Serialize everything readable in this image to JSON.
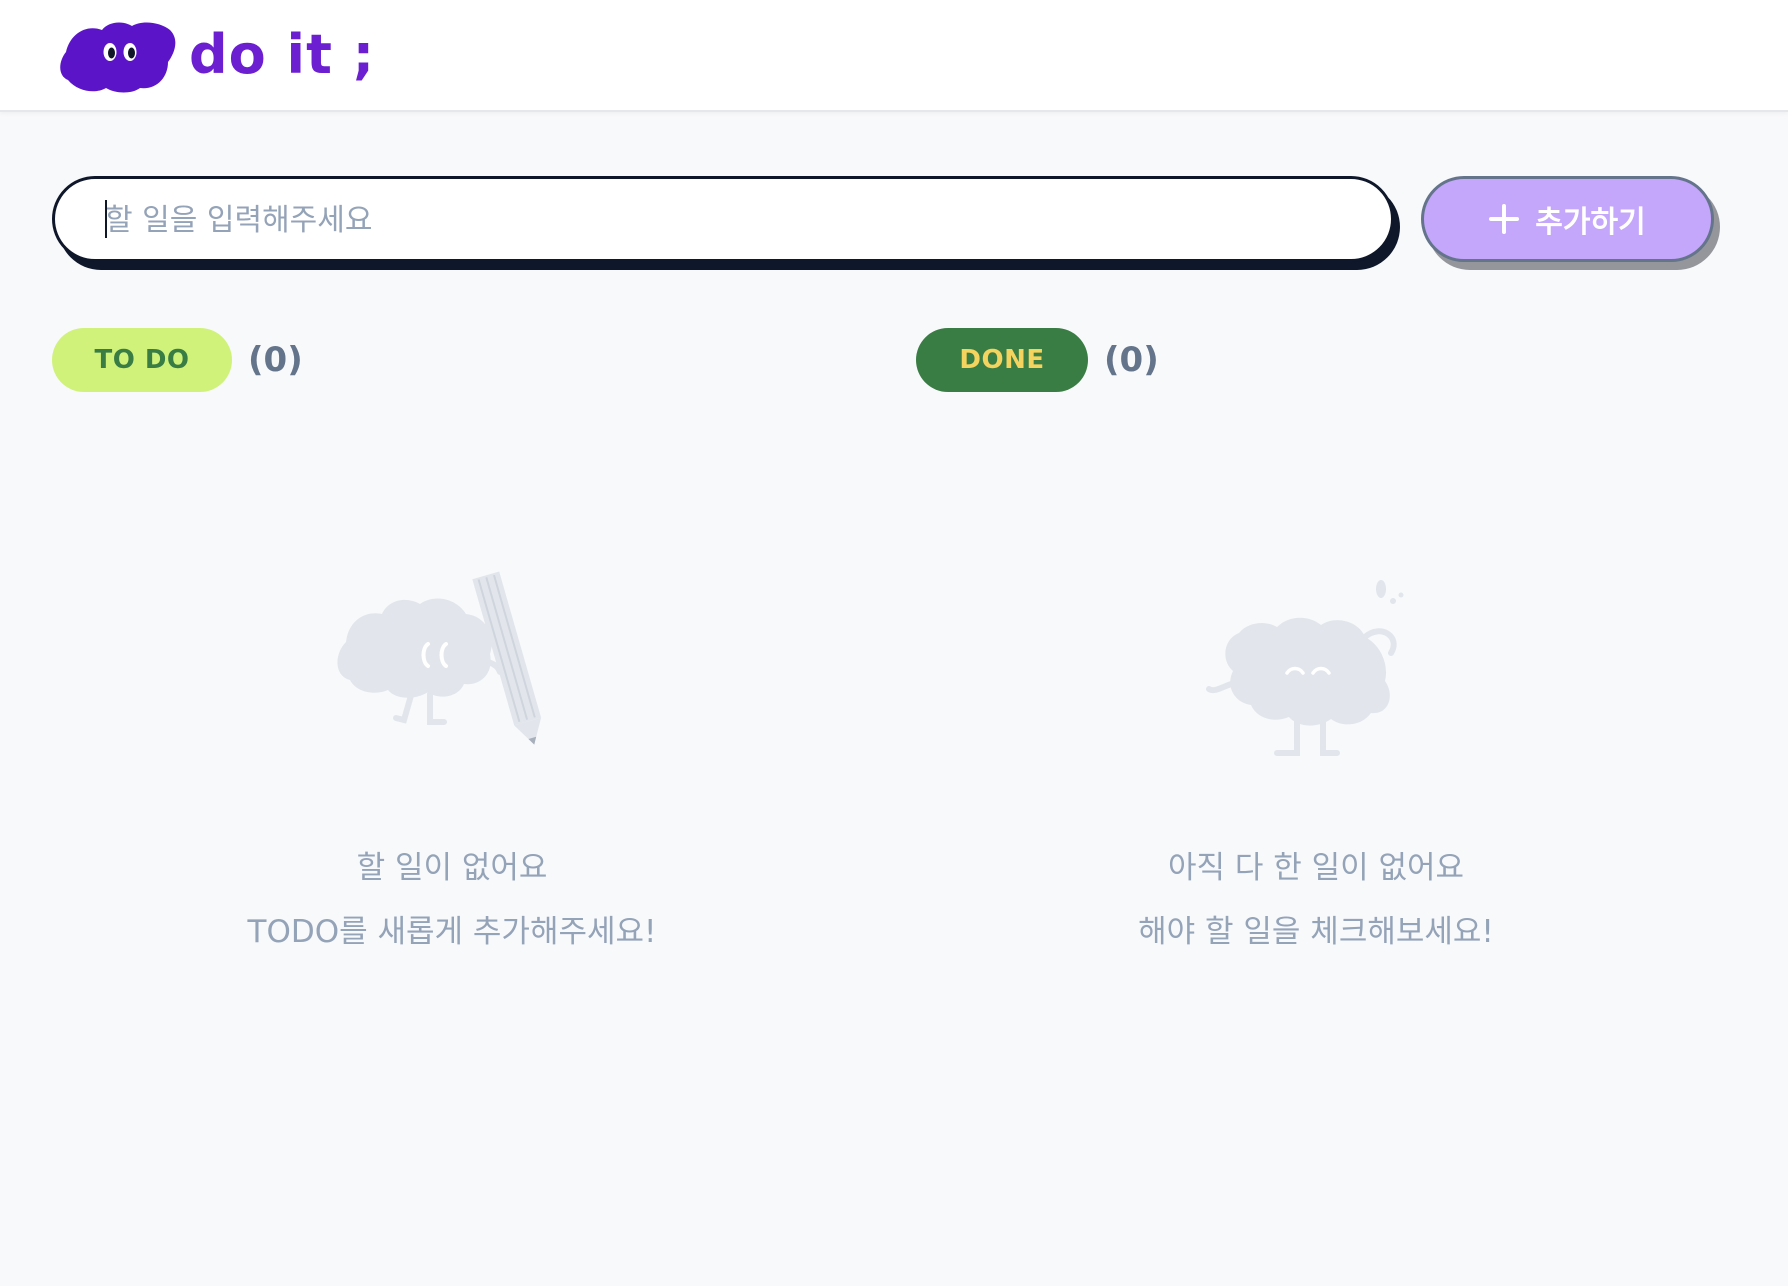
{
  "header": {
    "logo_text": "do it ;"
  },
  "add_form": {
    "input_placeholder": "할 일을 입력해주세요",
    "input_value": "",
    "add_button_label": "추가하기",
    "add_button_icon": "plus-icon"
  },
  "todo_section": {
    "badge_label": "TO DO",
    "count": "(0)",
    "empty_title": "할 일이 없어요",
    "empty_subtitle": "TODO를 새롭게 추가해주세요!",
    "illustration": "empty-todo-illustration"
  },
  "done_section": {
    "badge_label": "DONE",
    "count": "(0)",
    "empty_title": "아직 다 한 일이 없어요",
    "empty_subtitle": "해야 할 일을 체크해보세요!",
    "illustration": "empty-done-illustration"
  },
  "colors": {
    "brand_purple": "#6b1fd1",
    "add_button": "#c4a6fb",
    "todo_badge_bg": "#d0f27b",
    "todo_badge_text": "#3a7d44",
    "done_badge_bg": "#3a7d44",
    "done_badge_text": "#f4d35e",
    "muted_text": "#94a3b8"
  }
}
